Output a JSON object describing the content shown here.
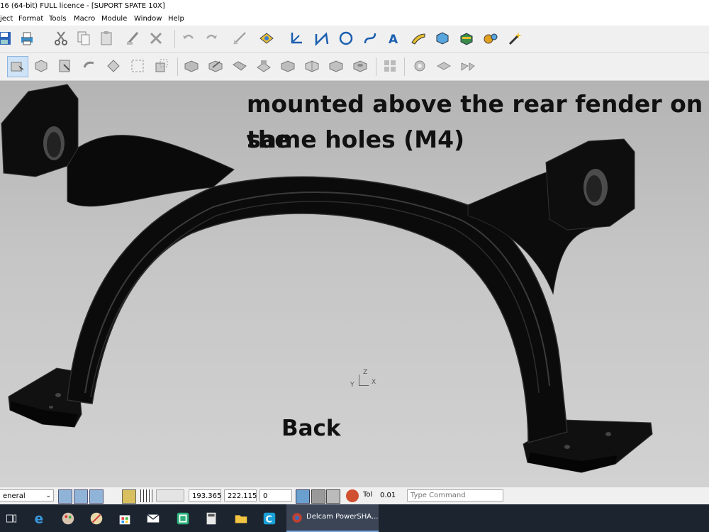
{
  "window": {
    "title": "16 (64-bit) FULL licence - [SUPORT SPATE 10X]"
  },
  "menu": [
    "ject",
    "Format",
    "Tools",
    "Macro",
    "Module",
    "Window",
    "Help"
  ],
  "toolbar1_icons": [
    "save-icon",
    "print-icon",
    "cut-icon",
    "copy-icon",
    "paste-icon",
    "delete-icon",
    "undo-icon",
    "redo-icon",
    "sketch-icon",
    "tint-icon",
    "workplane-icon",
    "line-icon",
    "circle-icon",
    "curve-icon",
    "text-icon",
    "surface-icon",
    "solid-icon",
    "drill-icon",
    "macro-icon",
    "wizard-icon"
  ],
  "toolbar2_icons": [
    "view-icon",
    "view-iso-icon",
    "view-top-icon",
    "rotate-icon",
    "fit-icon",
    "box-select-icon",
    "shaded-icon",
    "solid-edit-icon",
    "solid-view-icon",
    "blend-icon",
    "extrude-icon",
    "shell-icon",
    "feature-icon",
    "drill-feature-icon",
    "array-icon",
    "settings-icon",
    "fillet-icon",
    "transform-icon"
  ],
  "annotations": {
    "caption_line1": "mounted above the rear fender on the",
    "caption_line2": "same holes (M4)",
    "back_label": "Back"
  },
  "triad": {
    "z": "Z",
    "x": "X",
    "y": "Y"
  },
  "status": {
    "mode_value": "eneral",
    "coord_x": "193.365",
    "coord_y": "222.115",
    "coord_z": "0",
    "tol_label": "Tol",
    "tol_value": "0.01",
    "command_placeholder": "Type Command"
  },
  "taskbar": {
    "active_app_label": "Delcam PowerSHA..."
  },
  "colors": {
    "viewport_top": "#b4b4b4",
    "model": "#0d0d0d",
    "taskbar": "#1c2430"
  }
}
